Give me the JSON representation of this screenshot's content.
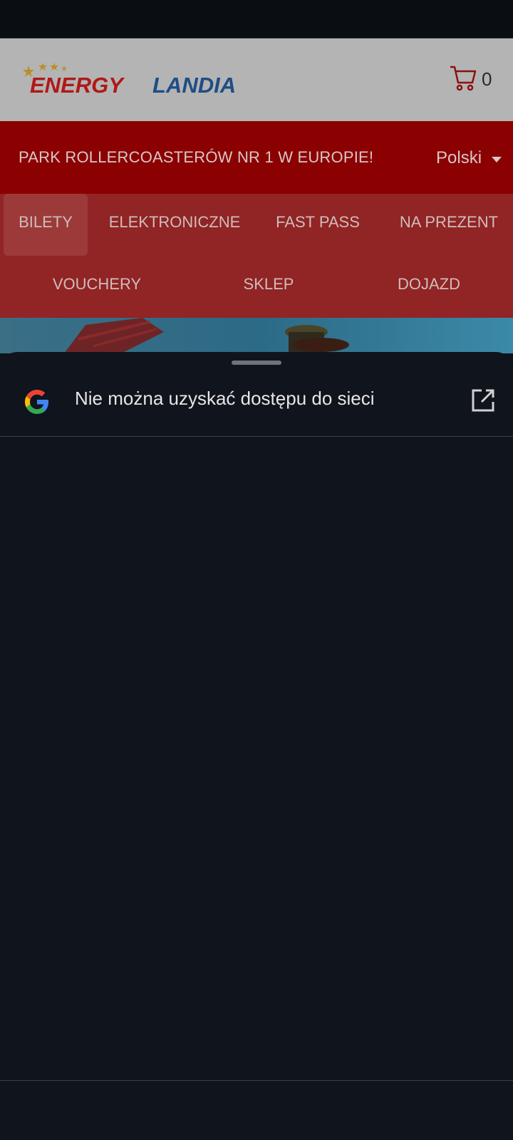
{
  "header": {
    "logo_text": "ENERGYLANDIA",
    "cart_count": "0"
  },
  "promo": {
    "text": "PARK ROLLERCOASTERÓW NR 1 W EUROPIE!",
    "language": "Polski"
  },
  "nav": {
    "items": [
      {
        "label": "BILETY",
        "active": true
      },
      {
        "label": "ELEKTRONICZNE"
      },
      {
        "label": "FAST PASS"
      },
      {
        "label": "NA PREZENT"
      },
      {
        "label": "VOUCHERY"
      },
      {
        "label": "SKLEP"
      },
      {
        "label": "DOJAZD"
      }
    ]
  },
  "sheet": {
    "title": "Nie można uzyskać dostępu do sieci"
  },
  "colors": {
    "promo_bg": "#8b0000",
    "nav_bg": "#912424",
    "sheet_bg": "#10141c"
  },
  "icons": [
    "cart-icon",
    "caret-down-icon",
    "google-icon",
    "open-external-icon"
  ]
}
